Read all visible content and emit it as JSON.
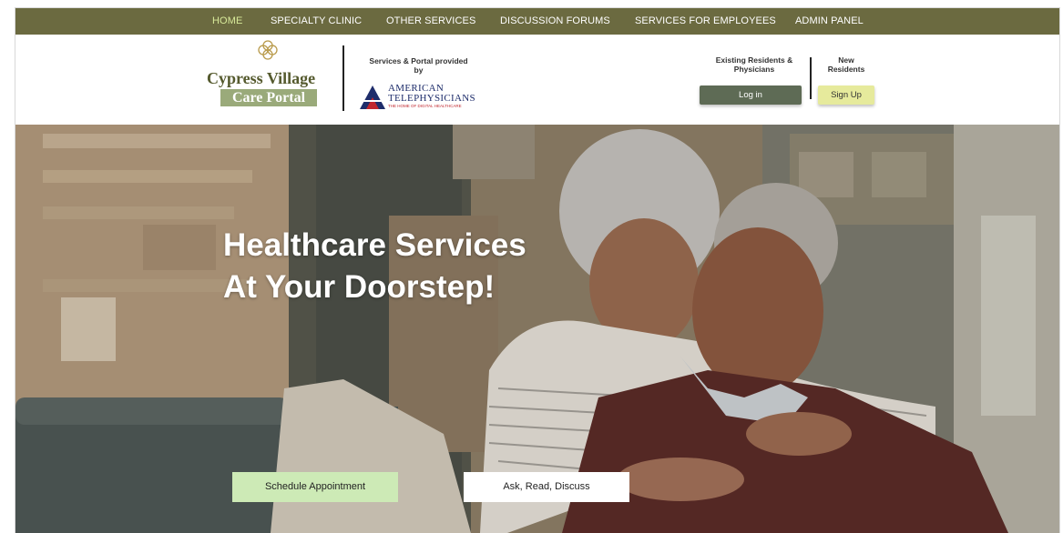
{
  "nav": {
    "items": [
      {
        "label": "HOME",
        "active": true
      },
      {
        "label": "SPECIALTY CLINIC"
      },
      {
        "label": "OTHER SERVICES"
      },
      {
        "label": "DISCUSSION FORUMS"
      },
      {
        "label": "SERVICES FOR EMPLOYEES"
      },
      {
        "label": "ADMIN PANEL"
      }
    ]
  },
  "header": {
    "brand_line1": "Cypress Village",
    "brand_line2": "Care Portal",
    "provided_by": "Services & Portal provided by",
    "partner_line1": "AMERICAN",
    "partner_line2": "TELEPHYSICIANS",
    "partner_tagline": "THE HOME OF DIGITAL HEALTHCARE",
    "existing_label": "Existing Residents & Physicians",
    "new_label": "New Residents",
    "login_label": "Log in",
    "signup_label": "Sign Up"
  },
  "hero": {
    "title_line1": "Healthcare Services",
    "title_line2": "At Your Doorstep!",
    "schedule_label": "Schedule Appointment",
    "ask_label": "Ask, Read, Discuss"
  },
  "colors": {
    "nav_bg": "#6b6a40",
    "nav_active": "#d8ea9a",
    "brand_text": "#555a2e",
    "brand_badge": "#9aaa7a",
    "login_bg": "#5e6b55",
    "signup_bg": "#e6ea9c",
    "schedule_bg": "#cdeab6"
  }
}
